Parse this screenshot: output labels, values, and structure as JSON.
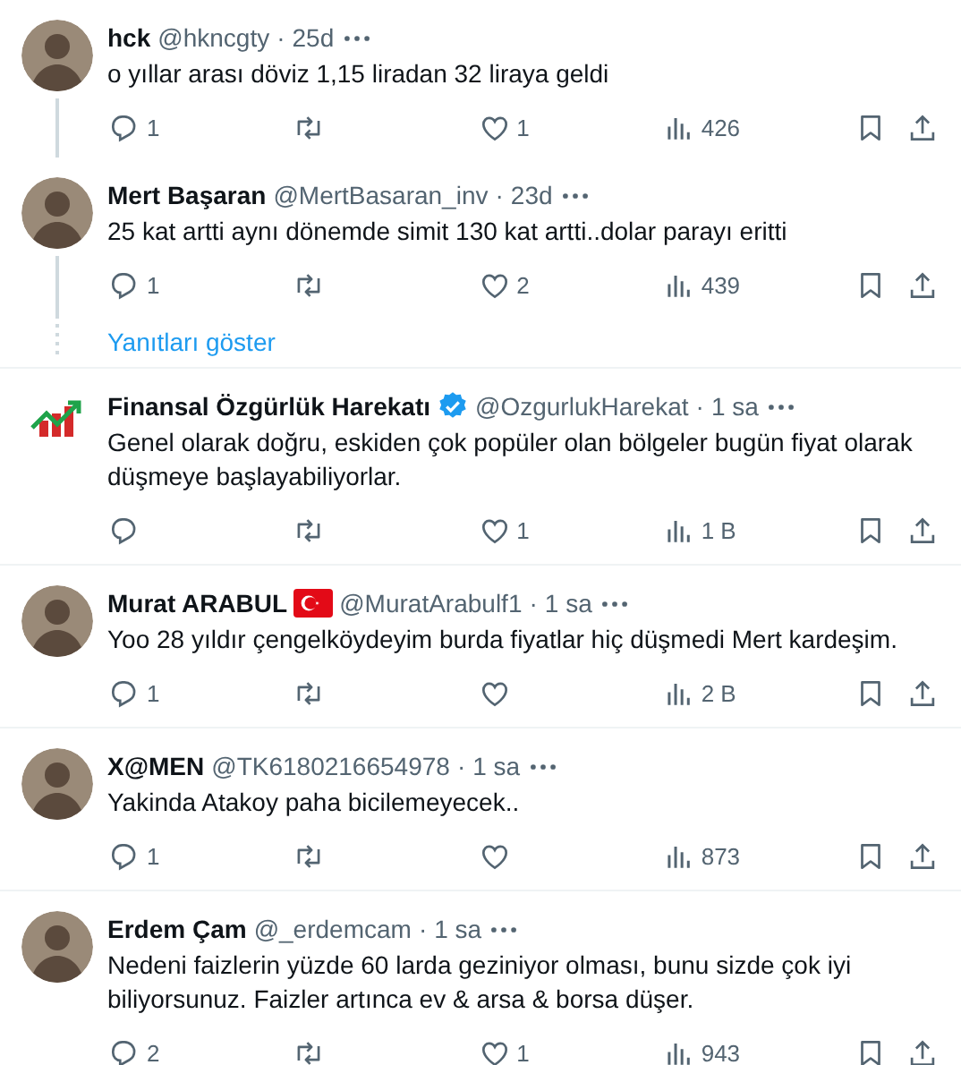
{
  "thread": {
    "tweets": [
      {
        "name": "hck",
        "handle": "@hkncgty",
        "dot": "·",
        "time": "25d",
        "avatar": {
          "kind": "photo"
        },
        "text": "o yıllar arası döviz 1,15 liradan 32 liraya geldi",
        "replies": "1",
        "likes": "1",
        "views": "426"
      },
      {
        "name": "Mert Başaran",
        "handle": "@MertBasaran_inv",
        "dot": "·",
        "time": "23d",
        "avatar": {
          "kind": "photo"
        },
        "text": "25 kat artti aynı dönemde simit 130 kat artti..dolar parayı eritti",
        "replies": "1",
        "likes": "2",
        "views": "439"
      }
    ],
    "show_replies": "Yanıtları göster"
  },
  "replies": [
    {
      "name": "Finansal Özgürlük Harekatı",
      "badge": {
        "kind": "verified"
      },
      "handle": "@OzgurlukHarekat",
      "dot": "·",
      "time": "1 sa",
      "avatar": {
        "kind": "logo"
      },
      "text": "Genel olarak doğru, eskiden çok popüler olan bölgeler bugün fiyat olarak düşmeye başlayabiliyorlar.",
      "likes": "1",
      "views": "1 B"
    },
    {
      "name": "Murat ARABUL",
      "badge": {
        "kind": "flag"
      },
      "handle": "@MuratArabulf1",
      "dot": "·",
      "time": "1 sa",
      "avatar": {
        "kind": "photo"
      },
      "text": "Yoo 28 yıldır çengelköydeyim burda fiyatlar hiç düşmedi Mert kardeşim.",
      "replies": "1",
      "views": "2 B"
    },
    {
      "name": "X@MEN",
      "handle": "@TK6180216654978",
      "dot": "·",
      "time": "1 sa",
      "avatar": {
        "kind": "photo"
      },
      "text": "Yakinda Atakoy paha bicilemeyecek..",
      "replies": "1",
      "views": "873"
    },
    {
      "name": "Erdem Çam",
      "handle": "@_erdemcam",
      "dot": "·",
      "time": "1 sa",
      "avatar": {
        "kind": "photo"
      },
      "text": "Nedeni faizlerin yüzde 60 larda geziniyor olması, bunu sizde çok iyi biliyorsunuz. Faizler artınca ev & arsa & borsa düşer.",
      "replies": "2",
      "likes": "1",
      "views": "943"
    }
  ]
}
